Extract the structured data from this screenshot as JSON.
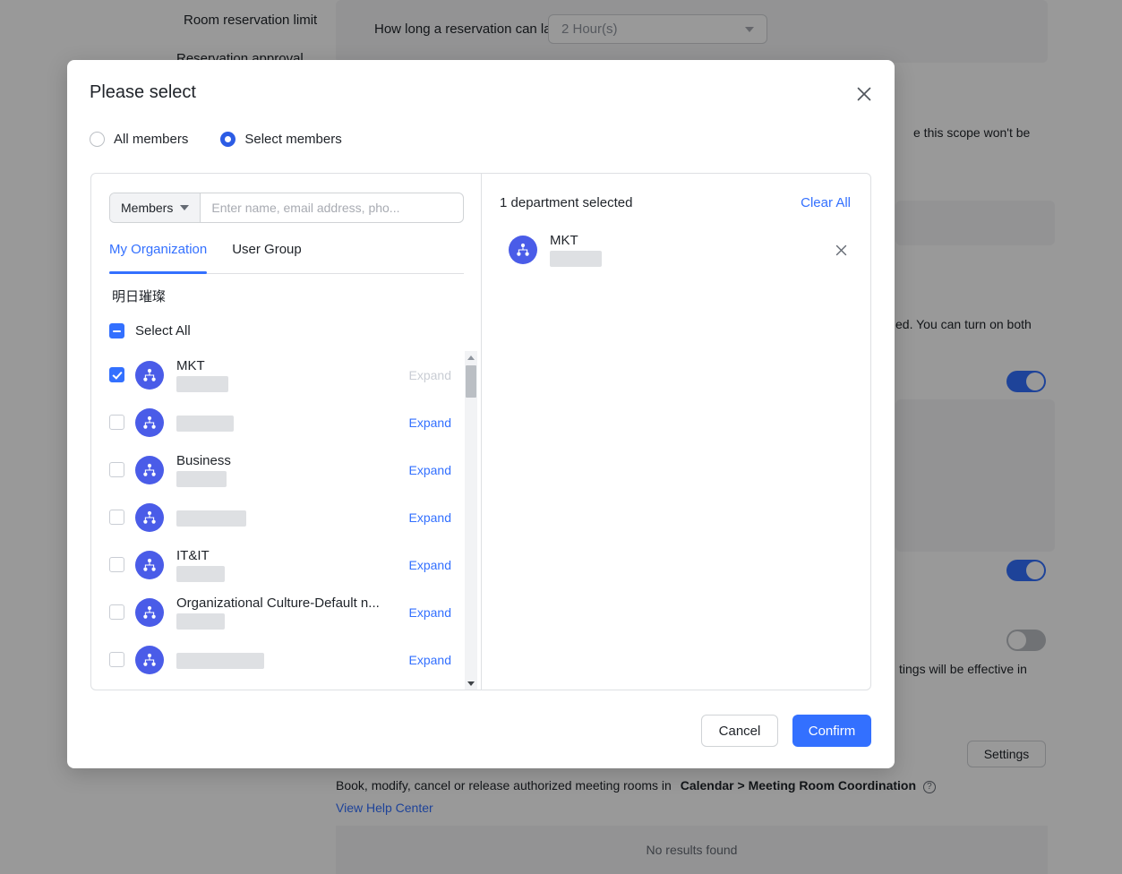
{
  "background": {
    "labels": {
      "room_reservation_limit": "Room reservation limit",
      "reservation_approval": "Reservation approval"
    },
    "fields": {
      "duration_label": "How long a reservation can last",
      "duration_value": "2 Hour(s)"
    },
    "notes": {
      "scope_note": "e this scope won't be",
      "turn_on_note": "ed. You can turn on both",
      "effective_note": "tings will be effective in"
    },
    "help": {
      "book_text": "Book, modify, cancel or release authorized meeting rooms in",
      "book_path": "Calendar > Meeting Room Coordination",
      "view_help_center": "View Help Center"
    },
    "settings_button": "Settings",
    "no_results": "No results found",
    "toggles": [
      {
        "name": "toggle-one",
        "state": "on"
      },
      {
        "name": "toggle-two",
        "state": "on"
      },
      {
        "name": "toggle-three",
        "state": "off"
      }
    ]
  },
  "modal": {
    "title": "Please select",
    "close_icon": "close-icon",
    "scope": {
      "options": [
        {
          "label": "All members",
          "selected": false
        },
        {
          "label": "Select members",
          "selected": true
        }
      ]
    },
    "search": {
      "select_value": "Members",
      "select_icon": "chevron-down-icon",
      "placeholder": "Enter name, email address, pho...",
      "value": ""
    },
    "tabs": [
      {
        "label": "My Organization",
        "active": true
      },
      {
        "label": "User Group",
        "active": false
      }
    ],
    "org_root": "明日璀璨",
    "select_all": {
      "label": "Select All",
      "state": "indeterminate"
    },
    "departments": [
      {
        "name": "MKT",
        "redacted_width": 58,
        "checked": true,
        "expand_label": "Expand",
        "expand_disabled": true,
        "avatar_icon": "org-tree-icon"
      },
      {
        "name": "",
        "redacted_width": 64,
        "checked": false,
        "expand_label": "Expand",
        "expand_disabled": false,
        "avatar_icon": "org-tree-icon"
      },
      {
        "name": "Business",
        "redacted_width": 56,
        "checked": false,
        "expand_label": "Expand",
        "expand_disabled": false,
        "avatar_icon": "org-tree-icon"
      },
      {
        "name": "",
        "redacted_width": 78,
        "checked": false,
        "expand_label": "Expand",
        "expand_disabled": false,
        "avatar_icon": "org-tree-icon"
      },
      {
        "name": "IT&IT",
        "redacted_width": 54,
        "checked": false,
        "expand_label": "Expand",
        "expand_disabled": false,
        "avatar_icon": "org-tree-icon"
      },
      {
        "name": "Organizational Culture-Default n...",
        "redacted_width": 54,
        "checked": false,
        "expand_label": "Expand",
        "expand_disabled": false,
        "avatar_icon": "org-tree-icon"
      },
      {
        "name": "",
        "redacted_width": 98,
        "checked": false,
        "expand_label": "Expand",
        "expand_disabled": false,
        "avatar_icon": "org-tree-icon"
      },
      {
        "name": "",
        "redacted_width": 128,
        "checked": false,
        "expand_label": "",
        "expand_disabled": false,
        "avatar_icon": "org-tree-icon"
      }
    ],
    "selection": {
      "count_text": "1 department selected",
      "clear_all": "Clear All",
      "items": [
        {
          "name": "MKT",
          "redacted_width": 58,
          "remove_icon": "close-icon",
          "avatar_icon": "org-tree-icon"
        }
      ]
    },
    "footer": {
      "cancel": "Cancel",
      "confirm": "Confirm"
    }
  },
  "colors": {
    "accent": "#3370ff",
    "avatar": "#4a5ce8",
    "radio_selected": "#2c5ce5",
    "redaction": "#dee0e3"
  }
}
